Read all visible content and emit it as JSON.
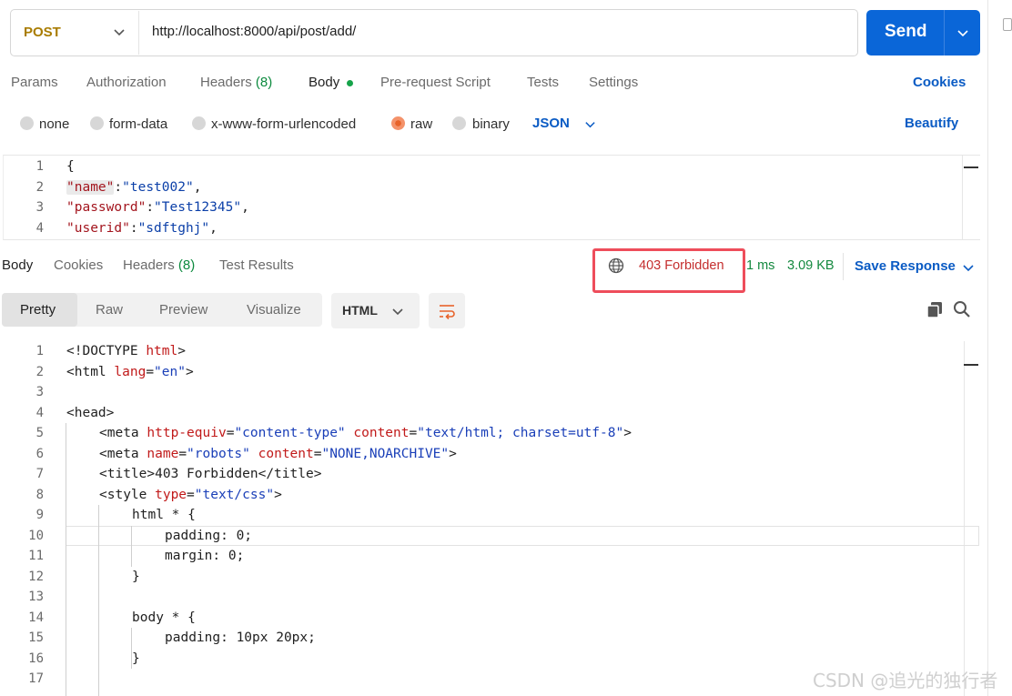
{
  "request": {
    "method": "POST",
    "url": "http://localhost:8000/api/post/add/",
    "send_label": "Send"
  },
  "request_tabs": [
    {
      "label": "Params"
    },
    {
      "label": "Authorization"
    },
    {
      "label": "Headers",
      "count": "(8)"
    },
    {
      "label": "Body",
      "active": true
    },
    {
      "label": "Pre-request Script"
    },
    {
      "label": "Tests"
    },
    {
      "label": "Settings"
    }
  ],
  "cookies_label": "Cookies",
  "body_types": {
    "options": [
      "none",
      "form-data",
      "x-www-form-urlencoded",
      "raw",
      "binary"
    ],
    "selected": "raw",
    "format": "JSON",
    "beautify_label": "Beautify"
  },
  "request_body": {
    "line_numbers": [
      "1",
      "2",
      "3",
      "4"
    ],
    "line1": "{",
    "l2_key": "\"name\"",
    "l2_sep": ":",
    "l2_val": "\"test002\"",
    "l2_end": ",",
    "l3_key": "\"password\"",
    "l3_sep": ":",
    "l3_val": "\"Test12345\"",
    "l3_end": ",",
    "l4_key": "\"userid\"",
    "l4_sep": ":",
    "l4_val": "\"sdftghj\"",
    "l4_end": ","
  },
  "response_tabs": [
    {
      "label": "Body",
      "active": true
    },
    {
      "label": "Cookies"
    },
    {
      "label": "Headers",
      "count": "(8)"
    },
    {
      "label": "Test Results"
    }
  ],
  "response_meta": {
    "status": "403 Forbidden",
    "time": "1 ms",
    "size": "3.09 KB",
    "save_label": "Save Response"
  },
  "view_modes": {
    "options": [
      "Pretty",
      "Raw",
      "Preview",
      "Visualize"
    ],
    "selected": "Pretty",
    "format": "HTML"
  },
  "response_body": {
    "line_numbers": [
      "1",
      "2",
      "3",
      "4",
      "5",
      "6",
      "7",
      "8",
      "9",
      "10",
      "11",
      "12",
      "13",
      "14",
      "15",
      "16",
      "17"
    ],
    "l1": [
      "<!DOCTYPE ",
      "html",
      ">"
    ],
    "l2": [
      "<html ",
      "lang",
      "=",
      "\"en\"",
      ">"
    ],
    "l4": "<head>",
    "l5": [
      "<meta ",
      "http-equiv",
      "=",
      "\"content-type\"",
      " ",
      "content",
      "=",
      "\"text/html; charset=utf-8\"",
      ">"
    ],
    "l6": [
      "<meta ",
      "name",
      "=",
      "\"robots\"",
      " ",
      "content",
      "=",
      "\"NONE,NOARCHIVE\"",
      ">"
    ],
    "l7": "<title>403 Forbidden</title>",
    "l8": [
      "<style ",
      "type",
      "=",
      "\"text/css\"",
      ">"
    ],
    "l9": "html * {",
    "l10": "padding: 0;",
    "l11": "margin: 0;",
    "l12": "}",
    "l14": "body * {",
    "l15": "padding: 10px 20px;",
    "l16": "}"
  },
  "watermark": "CSDN @追光的独行者",
  "colors": {
    "send_button": "#0a66d8",
    "method_post": "#a97c00",
    "link_blue": "#0a5bc4",
    "status_error": "#c42e2e",
    "status_ok_green": "#14893f",
    "highlight_box": "#ee4d5b"
  }
}
